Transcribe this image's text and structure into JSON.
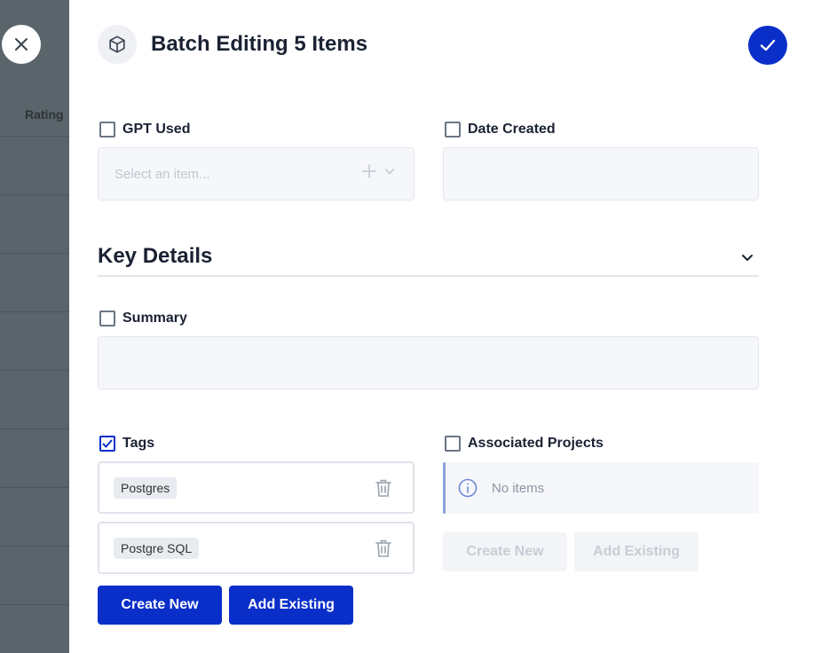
{
  "background": {
    "column_label": "Rating"
  },
  "header": {
    "title": "Batch Editing 5 Items",
    "icon": "cube-icon",
    "close_icon": "close-icon",
    "confirm_icon": "checkmark-icon"
  },
  "fields": {
    "gpt_used": {
      "label": "GPT Used",
      "checked": false,
      "placeholder": "Select an item..."
    },
    "date_created": {
      "label": "Date Created",
      "checked": false,
      "value": ""
    }
  },
  "key_details": {
    "title": "Key Details",
    "summary": {
      "label": "Summary",
      "checked": false,
      "value": ""
    }
  },
  "tags": {
    "label": "Tags",
    "checked": true,
    "items": [
      "Postgres",
      "Postgre SQL"
    ],
    "create_new_label": "Create New",
    "add_existing_label": "Add Existing"
  },
  "associated_projects": {
    "label": "Associated Projects",
    "checked": false,
    "empty_text": "No items",
    "create_new_label": "Create New",
    "add_existing_label": "Add Existing"
  },
  "colors": {
    "primary": "#0a2fc9",
    "backdrop": "#59646b"
  }
}
